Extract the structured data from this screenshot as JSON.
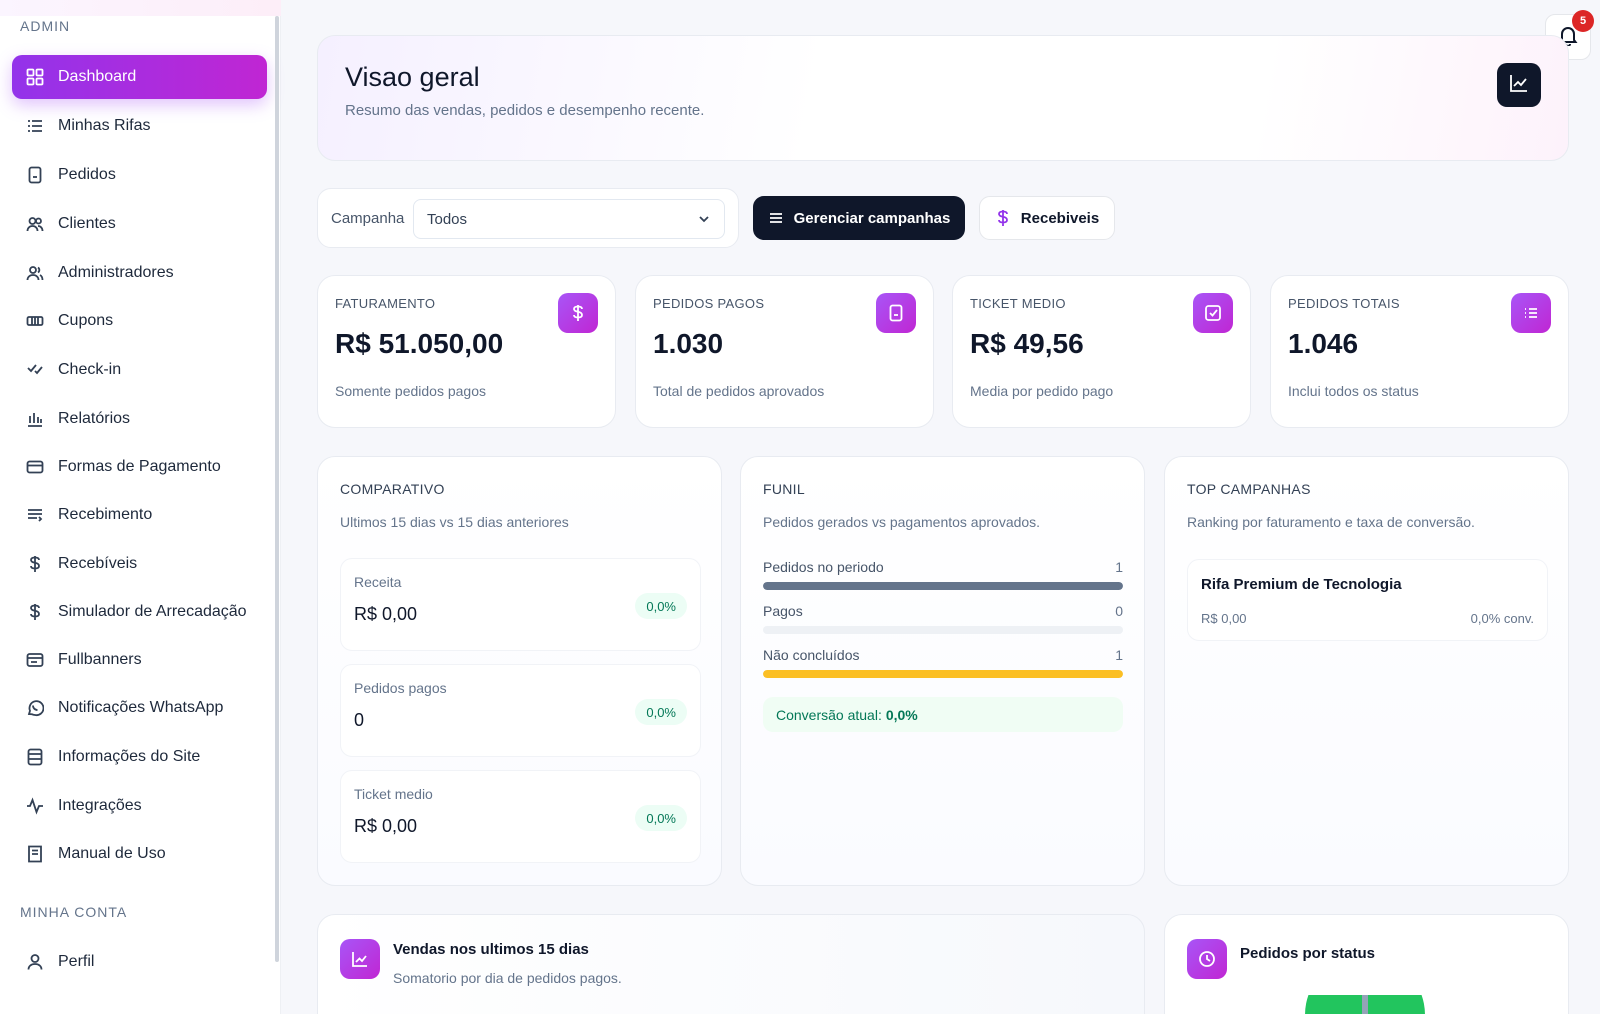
{
  "sidebar": {
    "section_admin": "ADMIN",
    "section_account": "MINHA CONTA",
    "items": [
      {
        "label": "Dashboard",
        "icon": "grid-icon"
      },
      {
        "label": "Minhas Rifas",
        "icon": "list-icon"
      },
      {
        "label": "Pedidos",
        "icon": "document-icon"
      },
      {
        "label": "Clientes",
        "icon": "users-icon"
      },
      {
        "label": "Administradores",
        "icon": "user-group-icon"
      },
      {
        "label": "Cupons",
        "icon": "ticket-icon"
      },
      {
        "label": "Check-in",
        "icon": "check-icon"
      },
      {
        "label": "Relatórios",
        "icon": "bar-chart-icon"
      },
      {
        "label": "Formas de Pagamento",
        "icon": "credit-card-icon"
      },
      {
        "label": "Recebimento",
        "icon": "list-filter-icon"
      },
      {
        "label": "Recebíveis",
        "icon": "dollar-icon"
      },
      {
        "label": "Simulador de Arrecadação",
        "icon": "dollar-icon"
      },
      {
        "label": "Fullbanners",
        "icon": "banner-icon"
      },
      {
        "label": "Notificações WhatsApp",
        "icon": "whatsapp-icon"
      },
      {
        "label": "Informações do Site",
        "icon": "archive-icon"
      },
      {
        "label": "Integrações",
        "icon": "activity-icon"
      },
      {
        "label": "Manual de Uso",
        "icon": "book-icon"
      }
    ],
    "account_items": [
      {
        "label": "Perfil",
        "icon": "user-icon"
      }
    ]
  },
  "notifications": {
    "count": "5"
  },
  "header": {
    "title": "Visao geral",
    "subtitle": "Resumo das vendas, pedidos e desempenho recente."
  },
  "filter": {
    "label": "Campanha",
    "selected": "Todos"
  },
  "actions": {
    "manage_label": "Gerenciar campanhas",
    "receivables_label": "Recebiveis"
  },
  "kpis": [
    {
      "label": "FATURAMENTO",
      "value": "R$ 51.050,00",
      "sub": "Somente pedidos pagos",
      "icon": "dollar-icon"
    },
    {
      "label": "PEDIDOS PAGOS",
      "value": "1.030",
      "sub": "Total de pedidos aprovados",
      "icon": "document-icon"
    },
    {
      "label": "TICKET MEDIO",
      "value": "R$ 49,56",
      "sub": "Media por pedido pago",
      "icon": "check-square-icon"
    },
    {
      "label": "PEDIDOS TOTAIS",
      "value": "1.046",
      "sub": "Inclui todos os status",
      "icon": "list-icon"
    }
  ],
  "comparativo": {
    "title": "COMPARATIVO",
    "subtitle": "Ultimos 15 dias vs 15 dias anteriores",
    "metrics": [
      {
        "label": "Receita",
        "value": "R$ 0,00",
        "delta": "0,0%"
      },
      {
        "label": "Pedidos pagos",
        "value": "0",
        "delta": "0,0%"
      },
      {
        "label": "Ticket medio",
        "value": "R$ 0,00",
        "delta": "0,0%"
      }
    ]
  },
  "funil": {
    "title": "FUNIL",
    "subtitle": "Pedidos gerados vs pagamentos aprovados.",
    "rows": [
      {
        "label": "Pedidos no periodo",
        "count": "1",
        "fill": 1.0,
        "color": "#64748b"
      },
      {
        "label": "Pagos",
        "count": "0",
        "fill": 0.0,
        "color": "#22c55e"
      },
      {
        "label": "Não concluídos",
        "count": "1",
        "fill": 1.0,
        "color": "#fbbf24"
      }
    ],
    "conversion_label": "Conversão atual:",
    "conversion_value": "0,0%"
  },
  "top_campanhas": {
    "title": "TOP CAMPANHAS",
    "subtitle": "Ranking por faturamento e taxa de conversão.",
    "items": [
      {
        "name": "Rifa Premium de Tecnologia",
        "revenue": "R$ 0,00",
        "conversion": "0,0% conv."
      }
    ]
  },
  "vendas": {
    "title": "Vendas nos ultimos 15 dias",
    "subtitle": "Somatorio por dia de pedidos pagos."
  },
  "status": {
    "title": "Pedidos por status"
  },
  "colors": {
    "accent": "#a855f7",
    "accent_2": "#c026d3",
    "dark": "#0f172a",
    "success": "#22c55e"
  }
}
